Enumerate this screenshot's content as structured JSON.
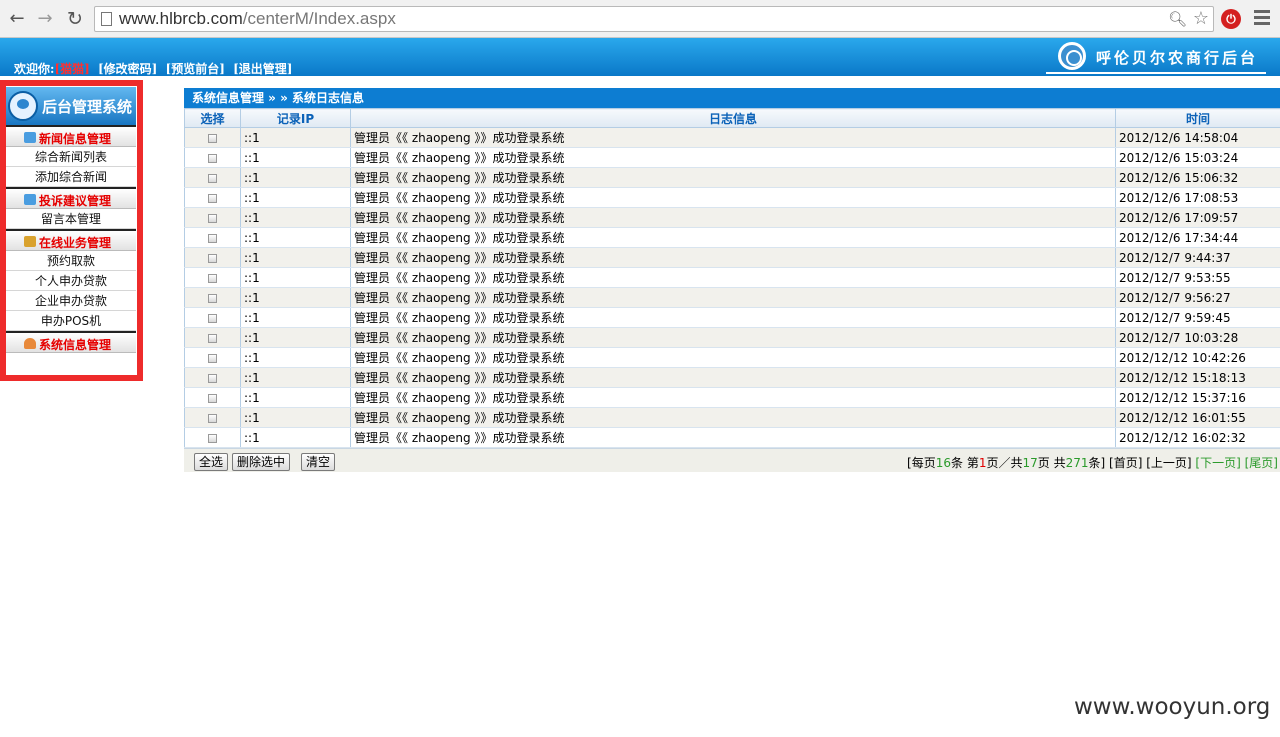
{
  "browser": {
    "url_host": "www.hlbrcb.com",
    "url_path": "/centerM/Index.aspx"
  },
  "header": {
    "welcome_label": "欢迎你:",
    "username": "[猫猫]",
    "links": [
      "[修改密码]",
      "[预览前台]",
      "[退出管理]"
    ],
    "brand_name": "呼伦贝尔农商行后台"
  },
  "sidebar": {
    "title": "后台管理系统",
    "groups": [
      {
        "label": "新闻信息管理",
        "icon": "news-icon",
        "items": [
          "综合新闻列表",
          "添加综合新闻"
        ]
      },
      {
        "label": "投诉建议管理",
        "icon": "feedback-icon",
        "items": [
          "留言本管理"
        ]
      },
      {
        "label": "在线业务管理",
        "icon": "business-icon",
        "items": [
          "预约取款",
          "个人申办贷款",
          "企业申办贷款",
          "申办POS机"
        ]
      },
      {
        "label": "系统信息管理",
        "icon": "user-icon",
        "items": []
      }
    ]
  },
  "main": {
    "breadcrumb": "系统信息管理 » » 系统日志信息",
    "columns": [
      "选择",
      "记录IP",
      "日志信息",
      "时间"
    ],
    "rows": [
      {
        "ip": "::1",
        "msg": "管理员《《 zhaopeng 》》成功登录系统",
        "time": "2012/12/6 14:58:04"
      },
      {
        "ip": "::1",
        "msg": "管理员《《 zhaopeng 》》成功登录系统",
        "time": "2012/12/6 15:03:24"
      },
      {
        "ip": "::1",
        "msg": "管理员《《 zhaopeng 》》成功登录系统",
        "time": "2012/12/6 15:06:32"
      },
      {
        "ip": "::1",
        "msg": "管理员《《 zhaopeng 》》成功登录系统",
        "time": "2012/12/6 17:08:53"
      },
      {
        "ip": "::1",
        "msg": "管理员《《 zhaopeng 》》成功登录系统",
        "time": "2012/12/6 17:09:57"
      },
      {
        "ip": "::1",
        "msg": "管理员《《 zhaopeng 》》成功登录系统",
        "time": "2012/12/6 17:34:44"
      },
      {
        "ip": "::1",
        "msg": "管理员《《 zhaopeng 》》成功登录系统",
        "time": "2012/12/7 9:44:37"
      },
      {
        "ip": "::1",
        "msg": "管理员《《 zhaopeng 》》成功登录系统",
        "time": "2012/12/7 9:53:55"
      },
      {
        "ip": "::1",
        "msg": "管理员《《 zhaopeng 》》成功登录系统",
        "time": "2012/12/7 9:56:27"
      },
      {
        "ip": "::1",
        "msg": "管理员《《 zhaopeng 》》成功登录系统",
        "time": "2012/12/7 9:59:45"
      },
      {
        "ip": "::1",
        "msg": "管理员《《 zhaopeng 》》成功登录系统",
        "time": "2012/12/7 10:03:28"
      },
      {
        "ip": "::1",
        "msg": "管理员《《 zhaopeng 》》成功登录系统",
        "time": "2012/12/12 10:42:26"
      },
      {
        "ip": "::1",
        "msg": "管理员《《 zhaopeng 》》成功登录系统",
        "time": "2012/12/12 15:18:13"
      },
      {
        "ip": "::1",
        "msg": "管理员《《 zhaopeng 》》成功登录系统",
        "time": "2012/12/12 15:37:16"
      },
      {
        "ip": "::1",
        "msg": "管理员《《 zhaopeng 》》成功登录系统",
        "time": "2012/12/12 16:01:55"
      },
      {
        "ip": "::1",
        "msg": "管理员《《 zhaopeng 》》成功登录系统",
        "time": "2012/12/12 16:02:32"
      }
    ],
    "buttons": {
      "select_all": "全选",
      "delete_selected": "删除选中",
      "clear": "清空"
    },
    "pager": {
      "per_page_prefix": "[每页",
      "per_page": "16",
      "per_page_suffix": "条 第",
      "current_page": "1",
      "mid1": "页／共",
      "total_pages": "17",
      "mid2": "页 共",
      "total_records": "271",
      "end": "条]",
      "first": "[首页]",
      "prev": "[上一页]",
      "next": "[下一页]",
      "last": "[尾页]"
    }
  },
  "watermark": "www.wooyun.org",
  "colors": {
    "header_blue": "#0a78c8",
    "crumb_blue": "#0d7dd2",
    "sidebar_highlight": "#ee2b2b",
    "group_label_red": "#e60000",
    "pager_green": "#2a9a2a"
  }
}
